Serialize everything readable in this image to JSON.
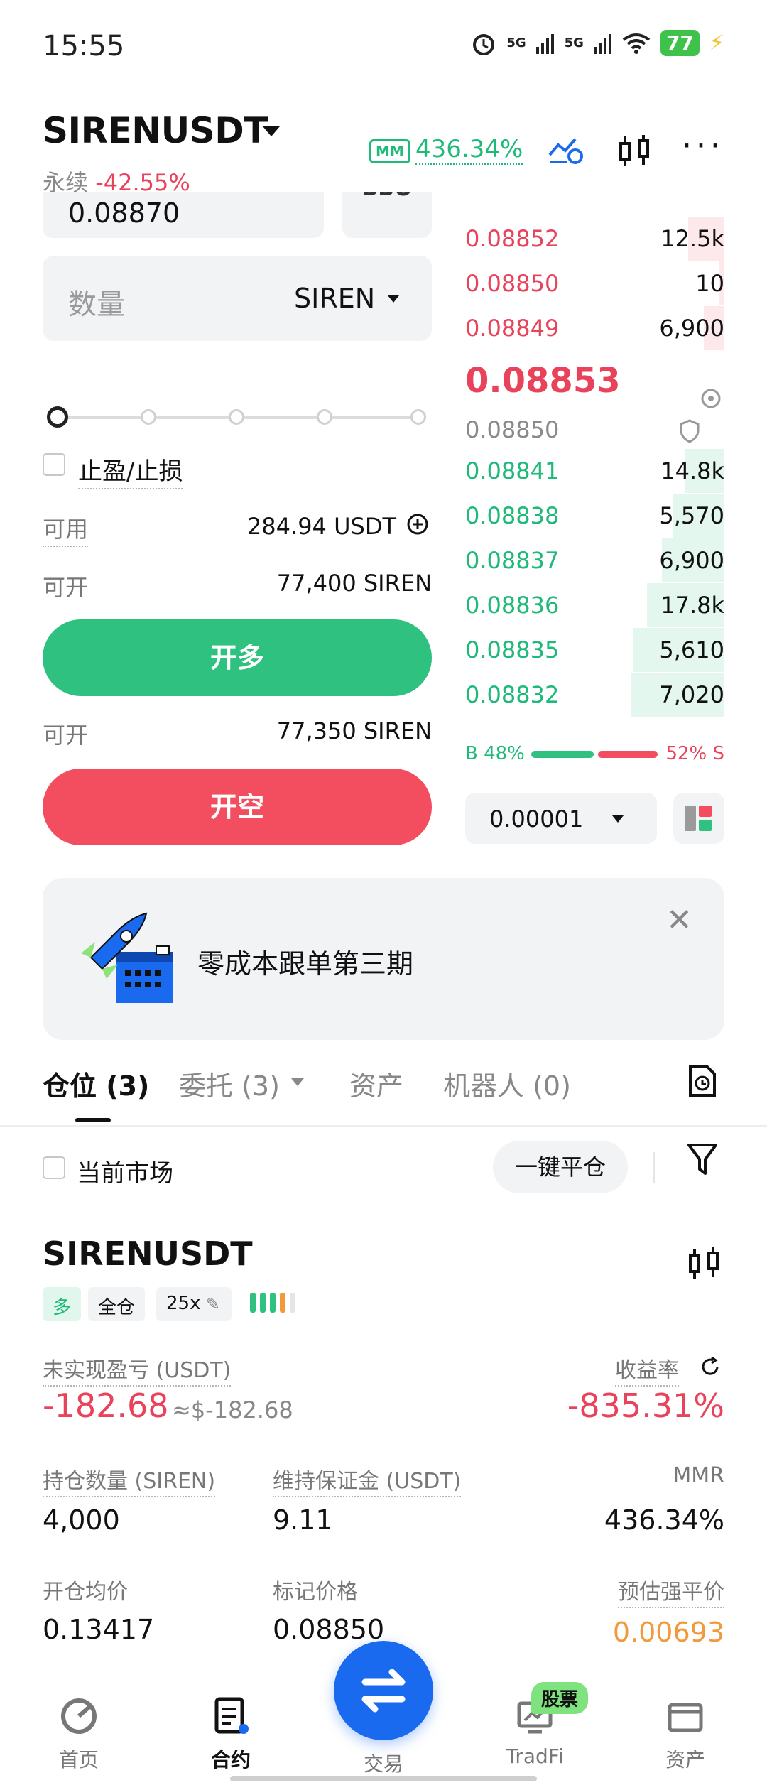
{
  "status_bar": {
    "time": "15:55",
    "net1": "5G",
    "net2": "5G",
    "battery": "77"
  },
  "header": {
    "symbol": "SIRENUSDT",
    "contract_type": "永续",
    "change_pct": "-42.55%",
    "mm_badge": "MM",
    "mm_ratio": "436.34%"
  },
  "order_form": {
    "price_value": "0.08870",
    "bbo_label": "BBO",
    "qty_placeholder": "数量",
    "qty_unit": "SIREN",
    "tp_sl_label": "止盈/止损",
    "available_label": "可用",
    "available_value": "284.94 USDT",
    "open_long_max_label": "可开",
    "open_long_max_value": "77,400 SIREN",
    "open_long_button": "开多",
    "open_short_max_label": "可开",
    "open_short_max_value": "77,350 SIREN",
    "open_short_button": "开空"
  },
  "order_book": {
    "asks": [
      {
        "price": "0.08852",
        "qty": "12.5k",
        "depth": 0.14
      },
      {
        "price": "0.08850",
        "qty": "10",
        "depth": 0.02
      },
      {
        "price": "0.08849",
        "qty": "6,900",
        "depth": 0.08
      }
    ],
    "last_price": "0.08853",
    "mark_price": "0.08850",
    "bids": [
      {
        "price": "0.08841",
        "qty": "14.8k",
        "depth": 0.15
      },
      {
        "price": "0.08838",
        "qty": "5,570",
        "depth": 0.2
      },
      {
        "price": "0.08837",
        "qty": "6,900",
        "depth": 0.24
      },
      {
        "price": "0.08836",
        "qty": "17.8k",
        "depth": 0.3
      },
      {
        "price": "0.08835",
        "qty": "5,610",
        "depth": 0.35
      },
      {
        "price": "0.08832",
        "qty": "7,020",
        "depth": 0.36
      }
    ],
    "buy_ratio": "B 48%",
    "sell_ratio": "52% S",
    "tick_size": "0.00001"
  },
  "banner": {
    "text": "零成本跟单第三期"
  },
  "tabs": [
    {
      "label": "仓位 (3)"
    },
    {
      "label": "委托 (3)"
    },
    {
      "label": "资产"
    },
    {
      "label": "机器人 (0)"
    }
  ],
  "positions_toolbar": {
    "current_market": "当前市场",
    "close_all": "一键平仓"
  },
  "position": {
    "symbol": "SIRENUSDT",
    "side": "多",
    "margin_mode": "全仓",
    "leverage": "25x",
    "upnl_label": "未实现盈亏 (USDT)",
    "upnl_value": "-182.68",
    "upnl_usd": "≈$-182.68",
    "roe_label": "收益率",
    "roe_value": "-835.31%",
    "size_label": "持仓数量 (SIREN)",
    "size_value": "4,000",
    "maint_margin_label": "维持保证金 (USDT)",
    "maint_margin_value": "9.11",
    "mmr_label": "MMR",
    "mmr_value": "436.34%",
    "entry_label": "开仓均价",
    "entry_value": "0.13417",
    "mark_label": "标记价格",
    "mark_value": "0.08850",
    "liq_label": "预估强平价",
    "liq_value": "0.00693"
  },
  "bottom_nav": {
    "home": "首页",
    "futures": "合约",
    "trade": "交易",
    "tradfi": "TradFi",
    "stock_badge": "股票",
    "assets": "资产"
  },
  "colors": {
    "green": "#1fb97a",
    "red": "#e9435c",
    "blue": "#1a6af0",
    "orange": "#f29a3b"
  }
}
